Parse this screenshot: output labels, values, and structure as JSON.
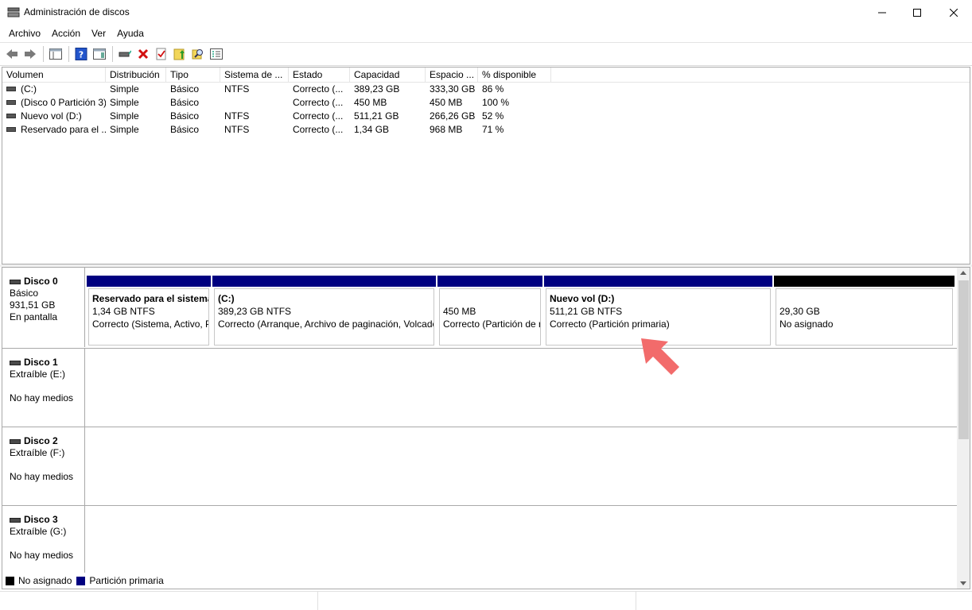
{
  "window": {
    "title": "Administración de discos",
    "controls": {
      "minimize": "minimize-icon",
      "maximize": "maximize-icon",
      "close": "close-icon"
    }
  },
  "menu": [
    "Archivo",
    "Acción",
    "Ver",
    "Ayuda"
  ],
  "toolbar": {
    "icons": [
      "back-arrow-icon",
      "forward-arrow-icon",
      "show-hide-console-tree-icon",
      "help-icon",
      "show-hide-action-pane-icon",
      "connect-disk-icon",
      "delete-icon",
      "check-icon",
      "folder-up-icon",
      "search-icon",
      "properties-icon"
    ]
  },
  "volume_list": {
    "columns": [
      "Volumen",
      "Distribución",
      "Tipo",
      "Sistema de ...",
      "Estado",
      "Capacidad",
      "Espacio ...",
      "% disponible"
    ],
    "rows": [
      {
        "volumen": "(C:)",
        "distribucion": "Simple",
        "tipo": "Básico",
        "sistema": "NTFS",
        "estado": "Correcto (...",
        "capacidad": "389,23 GB",
        "espacio": "333,30 GB",
        "disponible": "86 %"
      },
      {
        "volumen": "(Disco 0 Partición 3)",
        "distribucion": "Simple",
        "tipo": "Básico",
        "sistema": "",
        "estado": "Correcto (...",
        "capacidad": "450 MB",
        "espacio": "450 MB",
        "disponible": "100 %"
      },
      {
        "volumen": "Nuevo vol (D:)",
        "distribucion": "Simple",
        "tipo": "Básico",
        "sistema": "NTFS",
        "estado": "Correcto (...",
        "capacidad": "511,21 GB",
        "espacio": "266,26 GB",
        "disponible": "52 %"
      },
      {
        "volumen": "Reservado para el ...",
        "distribucion": "Simple",
        "tipo": "Básico",
        "sistema": "NTFS",
        "estado": "Correcto (...",
        "capacidad": "1,34 GB",
        "espacio": "968 MB",
        "disponible": "71 %"
      }
    ]
  },
  "disks": [
    {
      "name": "Disco 0",
      "type": "Básico",
      "size": "931,51 GB",
      "status": "En pantalla",
      "partitions": [
        {
          "title": "Reservado para el sistema",
          "size": "1,34 GB NTFS",
          "status": "Correcto (Sistema, Activo, Partición primaria)",
          "kind": "primary"
        },
        {
          "title": "(C:)",
          "size": "389,23 GB NTFS",
          "status": "Correcto (Arranque, Archivo de paginación, Volcado)",
          "kind": "primary"
        },
        {
          "title": "",
          "size": "450 MB",
          "status": "Correcto (Partición de recuperación)",
          "kind": "primary"
        },
        {
          "title": "Nuevo vol  (D:)",
          "size": "511,21 GB NTFS",
          "status": "Correcto (Partición primaria)",
          "kind": "primary"
        },
        {
          "title": "",
          "size": "29,30 GB",
          "status": "No asignado",
          "kind": "unallocated"
        }
      ]
    },
    {
      "name": "Disco 1",
      "type": "Extraíble (E:)",
      "size": "",
      "status": "No hay medios"
    },
    {
      "name": "Disco 2",
      "type": "Extraíble (F:)",
      "size": "",
      "status": "No hay medios"
    },
    {
      "name": "Disco 3",
      "type": "Extraíble (G:)",
      "size": "",
      "status": "No hay medios"
    }
  ],
  "legend": [
    {
      "label": "No asignado",
      "color": "#000000"
    },
    {
      "label": "Partición primaria",
      "color": "#000080"
    }
  ],
  "colors": {
    "primary_partition": "#000080",
    "unallocated": "#000000",
    "annotation_arrow": "#f26b6b"
  }
}
